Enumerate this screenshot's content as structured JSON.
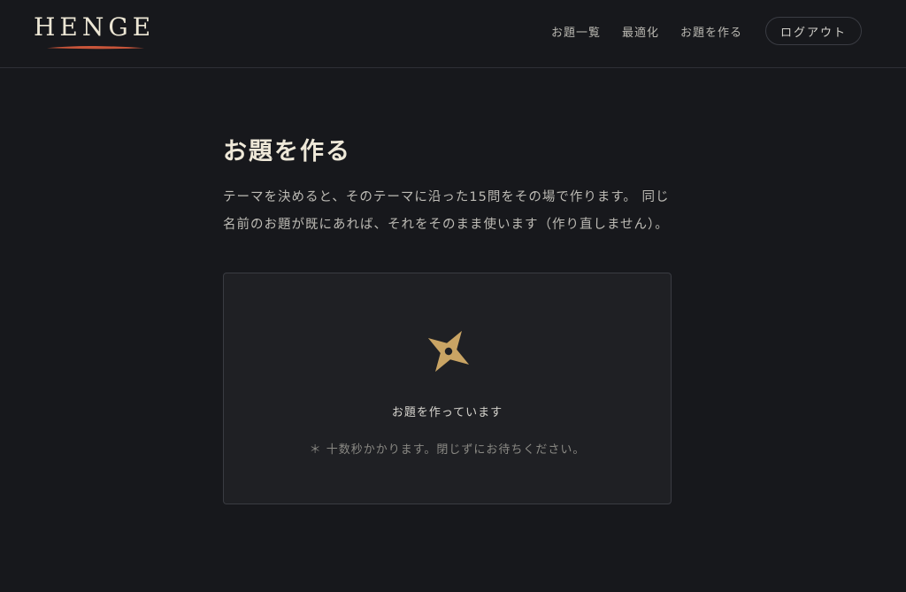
{
  "brand": {
    "name": "HENGE",
    "accent_color": "#c8553a"
  },
  "nav": {
    "items": [
      {
        "label": "お題一覧"
      },
      {
        "label": "最適化"
      },
      {
        "label": "お題を作る"
      }
    ],
    "logout_label": "ログアウト"
  },
  "main": {
    "title": "お題を作る",
    "description": "テーマを決めると、そのテーマに沿った15問をその場で作ります。 同じ名前のお題が既にあれば、それをそのまま使います（作り直しません）。"
  },
  "status": {
    "icon": "shuriken-icon",
    "icon_color": "#c9a464",
    "message": "お題を作っています",
    "note": "＊ 十数秒かかります。閉じずにお待ちください。"
  }
}
